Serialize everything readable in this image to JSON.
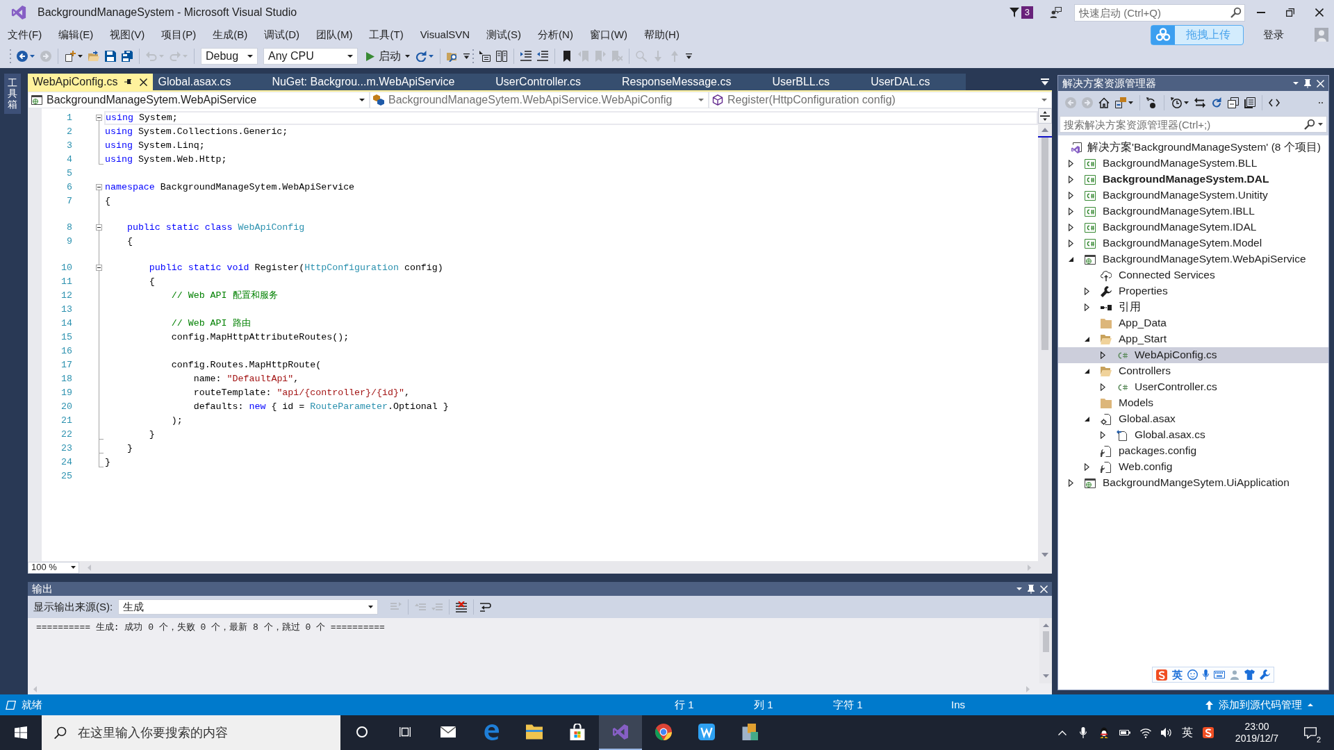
{
  "window": {
    "title": "BackgroundManageSystem - Microsoft Visual Studio",
    "notifications": "3",
    "quick_launch": {
      "placeholder": "快速启动 (Ctrl+Q)"
    },
    "upload_button": "拖拽上传",
    "sign_in": "登录"
  },
  "menu": [
    "文件(F)",
    "编辑(E)",
    "视图(V)",
    "项目(P)",
    "生成(B)",
    "调试(D)",
    "团队(M)",
    "工具(T)",
    "VisualSVN",
    "测试(S)",
    "分析(N)",
    "窗口(W)",
    "帮助(H)"
  ],
  "toolbar": {
    "buttons_before": [
      {
        "disabled": false
      },
      {
        "disabled": true
      },
      {
        "disabled": false
      },
      {
        "disabled": false
      },
      {
        "disabled": false
      },
      {
        "disabled": false
      },
      {
        "disabled": true
      },
      {
        "disabled": true
      }
    ],
    "configuration": "Debug",
    "platform": "Any CPU",
    "start": "启动",
    "buttons_after": [
      {
        "disabled": false
      },
      {
        "disabled": false
      },
      {
        "disabled": false
      },
      {
        "disabled": false
      },
      {
        "disabled": false
      },
      {
        "disabled": false
      },
      {
        "disabled": false
      },
      {
        "disabled": true
      },
      {
        "disabled": true
      },
      {
        "disabled": true
      },
      {
        "disabled": true
      },
      {
        "disabled": true
      },
      {
        "disabled": true
      }
    ]
  },
  "toolbox_tab": "工具箱",
  "document_tabs": [
    {
      "label": "WebApiConfig.cs",
      "selected": true
    },
    {
      "label": "Global.asax.cs",
      "selected": false
    },
    {
      "label": "NuGet: Backgrou...m.WebApiService",
      "selected": false
    },
    {
      "label": "UserController.cs",
      "selected": false
    },
    {
      "label": "ResponseMessage.cs",
      "selected": false
    },
    {
      "label": "UserBLL.cs",
      "selected": false
    },
    {
      "label": "UserDAL.cs",
      "selected": false
    }
  ],
  "navigation_bar": {
    "project": "BackgroundManageSytem.WebApiService",
    "type": "BackgroundManageSytem.WebApiService.WebApiConfig",
    "member": "Register(HttpConfiguration config)"
  },
  "editor": {
    "lines": [
      {
        "number": "1",
        "fold_start": true,
        "fold_end": false,
        "gap_above": false,
        "current": true,
        "tokens": [
          {
            "kind": "keyword",
            "text": "using"
          },
          {
            "kind": "plain",
            "text": " System;"
          }
        ]
      },
      {
        "number": "2",
        "fold_start": false,
        "fold_end": false,
        "gap_above": false,
        "current": false,
        "tokens": [
          {
            "kind": "keyword",
            "text": "using"
          },
          {
            "kind": "plain",
            "text": " System.Collections.Generic;"
          }
        ]
      },
      {
        "number": "3",
        "fold_start": false,
        "fold_end": false,
        "gap_above": false,
        "current": false,
        "tokens": [
          {
            "kind": "keyword",
            "text": "using"
          },
          {
            "kind": "plain",
            "text": " System.Linq;"
          }
        ]
      },
      {
        "number": "4",
        "fold_start": false,
        "fold_end": true,
        "gap_above": false,
        "current": false,
        "tokens": [
          {
            "kind": "keyword",
            "text": "using"
          },
          {
            "kind": "plain",
            "text": " System.Web.Http;"
          }
        ]
      },
      {
        "number": "5",
        "fold_start": false,
        "fold_end": false,
        "gap_above": false,
        "current": false
      },
      {
        "number": "6",
        "fold_start": true,
        "fold_end": false,
        "gap_above": false,
        "current": false,
        "tokens": [
          {
            "kind": "keyword",
            "text": "namespace"
          },
          {
            "kind": "plain",
            "text": " BackgroundManageSytem.WebApiService"
          }
        ]
      },
      {
        "number": "7",
        "fold_start": false,
        "fold_end": false,
        "gap_above": false,
        "current": false,
        "tokens": [
          {
            "kind": "plain",
            "text": "{"
          }
        ]
      },
      {
        "number": "8",
        "fold_start": true,
        "fold_end": false,
        "gap_above": true,
        "current": false,
        "tokens": [
          {
            "kind": "keyword",
            "text": "    public static class "
          },
          {
            "kind": "type",
            "text": "WebApiConfig"
          }
        ]
      },
      {
        "number": "9",
        "fold_start": false,
        "fold_end": false,
        "gap_above": false,
        "current": false,
        "tokens": [
          {
            "kind": "plain",
            "text": "    {"
          }
        ]
      },
      {
        "number": "10",
        "fold_start": true,
        "fold_end": false,
        "gap_above": true,
        "current": false,
        "tokens": [
          {
            "kind": "keyword",
            "text": "        public static void"
          },
          {
            "kind": "plain",
            "text": " Register("
          },
          {
            "kind": "type",
            "text": "HttpConfiguration"
          },
          {
            "kind": "plain",
            "text": " config)"
          }
        ]
      },
      {
        "number": "11",
        "fold_start": false,
        "fold_end": false,
        "gap_above": false,
        "current": false,
        "tokens": [
          {
            "kind": "plain",
            "text": "        {"
          }
        ]
      },
      {
        "number": "12",
        "fold_start": false,
        "fold_end": false,
        "gap_above": false,
        "current": false,
        "tokens": [
          {
            "kind": "comment",
            "text": "            // Web API 配置和服务"
          }
        ]
      },
      {
        "number": "13",
        "fold_start": false,
        "fold_end": false,
        "gap_above": false,
        "current": false
      },
      {
        "number": "14",
        "fold_start": false,
        "fold_end": false,
        "gap_above": false,
        "current": false,
        "tokens": [
          {
            "kind": "comment",
            "text": "            // Web API 路由"
          }
        ]
      },
      {
        "number": "15",
        "fold_start": false,
        "fold_end": false,
        "gap_above": false,
        "current": false,
        "tokens": [
          {
            "kind": "plain",
            "text": "            config.MapHttpAttributeRoutes();"
          }
        ]
      },
      {
        "number": "16",
        "fold_start": false,
        "fold_end": false,
        "gap_above": false,
        "current": false
      },
      {
        "number": "17",
        "fold_start": false,
        "fold_end": false,
        "gap_above": false,
        "current": false,
        "tokens": [
          {
            "kind": "plain",
            "text": "            config.Routes.MapHttpRoute("
          }
        ]
      },
      {
        "number": "18",
        "fold_start": false,
        "fold_end": false,
        "gap_above": false,
        "current": false,
        "tokens": [
          {
            "kind": "plain",
            "text": "                name: "
          },
          {
            "kind": "string",
            "text": "\"DefaultApi\""
          },
          {
            "kind": "plain",
            "text": ","
          }
        ]
      },
      {
        "number": "19",
        "fold_start": false,
        "fold_end": false,
        "gap_above": false,
        "current": false,
        "tokens": [
          {
            "kind": "plain",
            "text": "                routeTemplate: "
          },
          {
            "kind": "string",
            "text": "\"api/{controller}/{id}\""
          },
          {
            "kind": "plain",
            "text": ","
          }
        ]
      },
      {
        "number": "20",
        "fold_start": false,
        "fold_end": false,
        "gap_above": false,
        "current": false,
        "tokens": [
          {
            "kind": "plain",
            "text": "                defaults: "
          },
          {
            "kind": "keyword",
            "text": "new"
          },
          {
            "kind": "plain",
            "text": " { id = "
          },
          {
            "kind": "type",
            "text": "RouteParameter"
          },
          {
            "kind": "plain",
            "text": ".Optional }"
          }
        ]
      },
      {
        "number": "21",
        "fold_start": false,
        "fold_end": false,
        "gap_above": false,
        "current": false,
        "tokens": [
          {
            "kind": "plain",
            "text": "            );"
          }
        ]
      },
      {
        "number": "22",
        "fold_start": false,
        "fold_end": true,
        "gap_above": false,
        "current": false,
        "tokens": [
          {
            "kind": "plain",
            "text": "        }"
          }
        ]
      },
      {
        "number": "23",
        "fold_start": false,
        "fold_end": true,
        "gap_above": false,
        "current": false,
        "tokens": [
          {
            "kind": "plain",
            "text": "    }"
          }
        ]
      },
      {
        "number": "24",
        "fold_start": false,
        "fold_end": true,
        "gap_above": false,
        "current": false,
        "tokens": [
          {
            "kind": "plain",
            "text": "}"
          }
        ]
      },
      {
        "number": "25",
        "fold_start": false,
        "fold_end": false,
        "gap_above": false,
        "current": false
      }
    ],
    "zoom": "100 %"
  },
  "output": {
    "title": "输出",
    "source_label": "显示输出来源(S):",
    "source": "生成",
    "buttons": [
      {
        "disabled": true
      },
      {
        "disabled": true
      },
      {
        "disabled": true
      },
      {
        "disabled": false
      },
      {
        "disabled": false
      }
    ],
    "text": "========== 生成: 成功 0 个，失败 0 个，最新 8 个，跳过 0 个 =========="
  },
  "solution_explorer": {
    "title": "解决方案资源管理器",
    "buttons": [
      {
        "disabled": true
      },
      {
        "disabled": true
      },
      {
        "disabled": false
      },
      {
        "disabled": false
      },
      {
        "disabled": false
      },
      {
        "disabled": false
      },
      {
        "disabled": false
      },
      {
        "disabled": false
      },
      {
        "disabled": false
      },
      {
        "disabled": false
      },
      {
        "disabled": false
      }
    ],
    "search": {
      "placeholder": "搜索解决方案资源管理器(Ctrl+;)"
    },
    "tree": [
      {
        "label": "解决方案'BackgroundManageSystem' (8 个项目)",
        "kind": "solution",
        "selected": false,
        "children": [
          {
            "label": "BackgroundManageSystem.BLL",
            "kind": "project",
            "expanded": false,
            "startup": false,
            "selected": false
          },
          {
            "label": "BackgroundManageSystem.DAL",
            "kind": "project",
            "expanded": false,
            "startup": true,
            "selected": false
          },
          {
            "label": "BackgroundManageSystem.Unitity",
            "kind": "project",
            "expanded": false,
            "startup": false,
            "selected": false
          },
          {
            "label": "BackgroundManageSytem.IBLL",
            "kind": "project",
            "expanded": false,
            "startup": false,
            "selected": false
          },
          {
            "label": "BackgroundManageSytem.IDAL",
            "kind": "project",
            "expanded": false,
            "startup": false,
            "selected": false
          },
          {
            "label": "BackgroundManageSytem.Model",
            "kind": "project",
            "expanded": false,
            "startup": false,
            "selected": false
          },
          {
            "label": "BackgroundManageSytem.WebApiService",
            "kind": "web-project",
            "expanded": true,
            "startup": false,
            "selected": false,
            "children": [
              {
                "label": "Connected Services",
                "kind": "connected-services",
                "selected": false
              },
              {
                "label": "Properties",
                "kind": "properties",
                "expanded": false,
                "selected": false
              },
              {
                "label": "引用",
                "kind": "references",
                "expanded": false,
                "selected": false
              },
              {
                "label": "App_Data",
                "kind": "folder",
                "selected": false
              },
              {
                "label": "App_Start",
                "kind": "folder",
                "expanded": true,
                "selected": false,
                "children": [
                  {
                    "label": "WebApiConfig.cs",
                    "kind": "cs-file",
                    "expanded": false,
                    "selected": true
                  }
                ]
              },
              {
                "label": "Controllers",
                "kind": "folder",
                "expanded": true,
                "selected": false,
                "children": [
                  {
                    "label": "UserController.cs",
                    "kind": "cs-file",
                    "expanded": false,
                    "selected": false
                  }
                ]
              },
              {
                "label": "Models",
                "kind": "folder",
                "selected": false
              },
              {
                "label": "Global.asax",
                "kind": "asax",
                "expanded": true,
                "selected": false,
                "children": [
                  {
                    "label": "Global.asax.cs",
                    "kind": "code-file",
                    "expanded": false,
                    "selected": false
                  }
                ]
              },
              {
                "label": "packages.config",
                "kind": "config",
                "selected": false
              },
              {
                "label": "Web.config",
                "kind": "config",
                "expanded": false,
                "selected": false
              }
            ]
          },
          {
            "label": "BackgroundMangeSytem.UiApplication",
            "kind": "web-project",
            "expanded": false,
            "startup": false,
            "selected": false
          }
        ]
      }
    ]
  },
  "ime_toolbar": {
    "mode": "英"
  },
  "status_bar": {
    "state": "就绪",
    "line": "行 1",
    "column": "列 1",
    "character": "字符 1",
    "mode": "Ins",
    "source_control": "添加到源代码管理"
  },
  "taskbar": {
    "search": {
      "placeholder": "在这里输入你要搜索的内容"
    },
    "apps": [
      {
        "selected": false
      },
      {
        "selected": false
      },
      {
        "selected": false
      },
      {
        "selected": false
      },
      {
        "selected": false
      },
      {
        "selected": false
      },
      {
        "selected": true
      },
      {
        "selected": false
      },
      {
        "selected": false
      },
      {
        "selected": false
      }
    ],
    "input_language": "英",
    "time": "23:00",
    "date": "2019/12/7",
    "notifications": "2"
  }
}
